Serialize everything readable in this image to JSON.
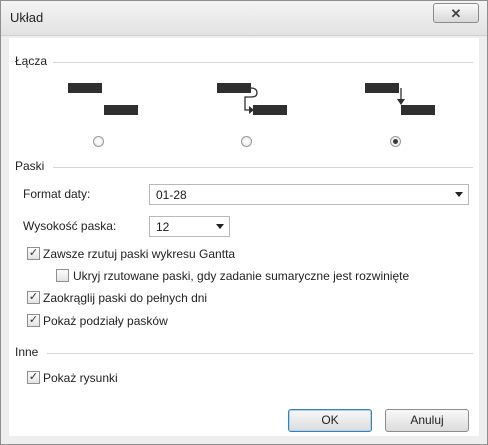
{
  "window": {
    "title": "Układ",
    "close_glyph": "✕"
  },
  "links_section": {
    "label": "Łącza",
    "options": [
      {
        "selected": false
      },
      {
        "selected": false
      },
      {
        "selected": true
      }
    ]
  },
  "bars_section": {
    "label": "Paski",
    "date_format": {
      "label": "Format daty:",
      "value": "01-28"
    },
    "bar_height": {
      "label": "Wysokość paska:",
      "value": "12"
    },
    "checks": [
      {
        "label": "Zawsze rzutuj paski wykresu Gantta",
        "checked": true
      },
      {
        "label": "Ukryj rzutowane paski, gdy zadanie sumaryczne jest rozwinięte",
        "checked": false
      },
      {
        "label": "Zaokrąglij paski do pełnych dni",
        "checked": true
      },
      {
        "label": "Pokaż podziały pasków",
        "checked": true
      }
    ]
  },
  "other_section": {
    "label": "Inne",
    "checks": [
      {
        "label": "Pokaż rysunki",
        "checked": true
      }
    ]
  },
  "buttons": {
    "ok": "OK",
    "cancel": "Anuluj"
  },
  "check_glyph": "✓"
}
